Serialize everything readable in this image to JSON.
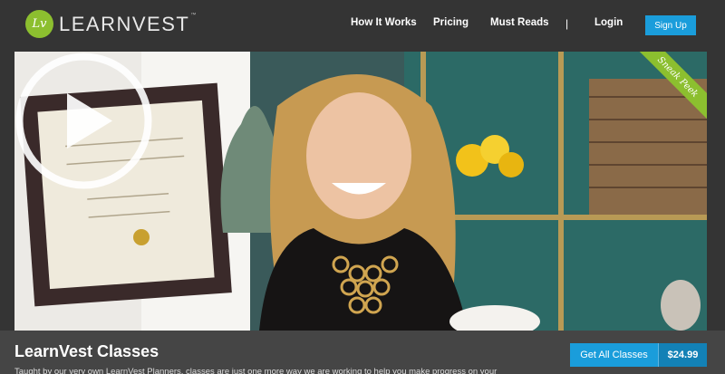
{
  "header": {
    "logo_badge": "Lv",
    "logo_text": "LEARNVEST",
    "logo_tm": "™",
    "nav": [
      {
        "label": "How It Works"
      },
      {
        "label": "Pricing"
      },
      {
        "label": "Must Reads"
      },
      {
        "label": "Login"
      }
    ],
    "separator": "|",
    "signup_label": "Sign Up"
  },
  "video": {
    "ribbon_label": "Sneak Peek",
    "icons": {
      "play": "play-circle-icon"
    }
  },
  "classes": {
    "title": "LearnVest Classes",
    "description": "Taught by our very own LearnVest Planners, classes are just one more way we are working to help you make progress on your",
    "cta_label": "Get All Classes",
    "price": "$24.99"
  },
  "colors": {
    "brand_green": "#8cbf2f",
    "accent_blue": "#1a9ddb",
    "background": "#343434"
  }
}
